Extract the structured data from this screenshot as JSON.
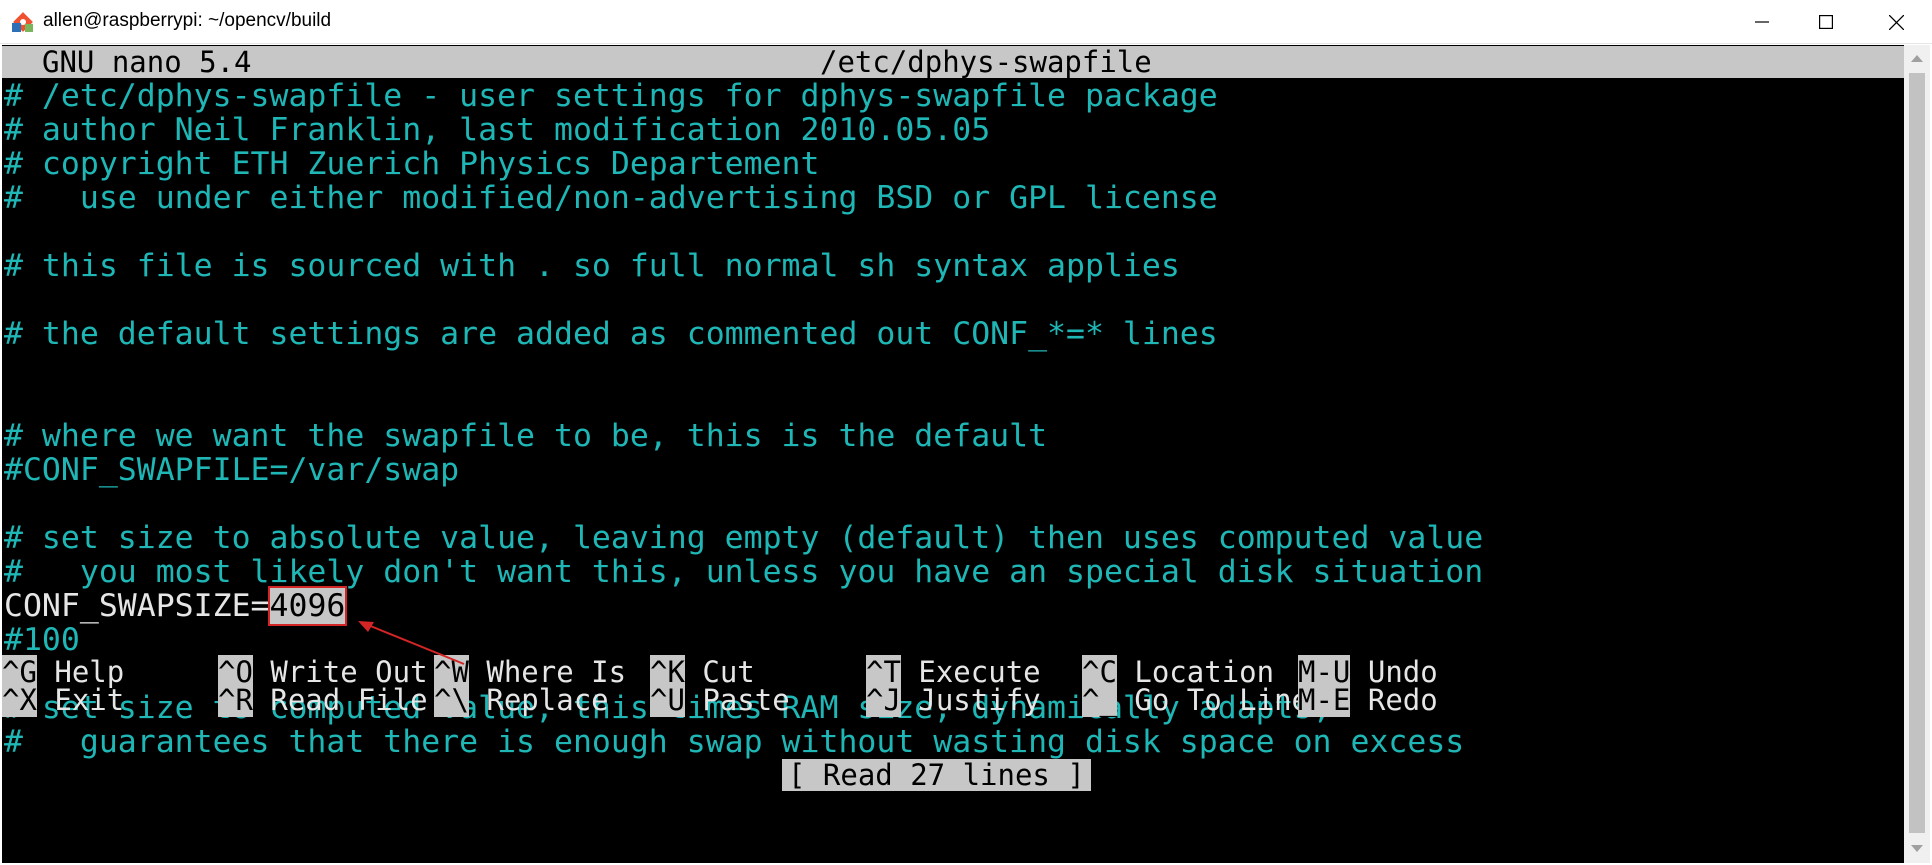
{
  "window": {
    "title": "allen@raspberrypi: ~/opencv/build",
    "icon": "git-bash-icon"
  },
  "nano": {
    "version": "GNU nano 5.4",
    "filename": "/etc/dphys-swapfile"
  },
  "file_lines": [
    {
      "text": "# /etc/dphys-swapfile - user settings for dphys-swapfile package",
      "kind": "comment"
    },
    {
      "text": "# author Neil Franklin, last modification 2010.05.05",
      "kind": "comment"
    },
    {
      "text": "# copyright ETH Zuerich Physics Departement",
      "kind": "comment"
    },
    {
      "text": "#   use under either modified/non-advertising BSD or GPL license",
      "kind": "comment"
    },
    {
      "text": "",
      "kind": "blank"
    },
    {
      "text": "# this file is sourced with . so full normal sh syntax applies",
      "kind": "comment"
    },
    {
      "text": "",
      "kind": "blank"
    },
    {
      "text": "# the default settings are added as commented out CONF_*=* lines",
      "kind": "comment"
    },
    {
      "text": "",
      "kind": "blank"
    },
    {
      "text": "",
      "kind": "blank"
    },
    {
      "text": "# where we want the swapfile to be, this is the default",
      "kind": "comment"
    },
    {
      "text": "#CONF_SWAPFILE=/var/swap",
      "kind": "comment"
    },
    {
      "text": "",
      "kind": "blank"
    },
    {
      "text": "# set size to absolute value, leaving empty (default) then uses computed value",
      "kind": "comment"
    },
    {
      "text": "#   you most likely don't want this, unless you have an special disk situation",
      "kind": "comment"
    },
    {
      "text": "",
      "kind": "setting"
    },
    {
      "text": "#100",
      "kind": "comment"
    },
    {
      "text": "",
      "kind": "blank"
    },
    {
      "text": "# set size to computed value, this times RAM size, dynamically adapts,",
      "kind": "comment"
    },
    {
      "text": "#   guarantees that there is enough swap without wasting disk space on excess",
      "kind": "comment"
    }
  ],
  "setting_line": {
    "key": "CONF_SWAPSIZE=",
    "value": "4096"
  },
  "status_message": "[ Read 27 lines ]",
  "shortcuts": [
    {
      "key": "^G",
      "label": "Help"
    },
    {
      "key": "^O",
      "label": "Write Out"
    },
    {
      "key": "^W",
      "label": "Where Is"
    },
    {
      "key": "^K",
      "label": "Cut"
    },
    {
      "key": "^T",
      "label": "Execute"
    },
    {
      "key": "^C",
      "label": "Location"
    },
    {
      "key": "M-U",
      "label": "Undo"
    },
    {
      "key": "^X",
      "label": "Exit"
    },
    {
      "key": "^R",
      "label": "Read File"
    },
    {
      "key": "^\\",
      "label": "Replace"
    },
    {
      "key": "^U",
      "label": "Paste"
    },
    {
      "key": "^J",
      "label": "Justify"
    },
    {
      "key": "^_",
      "label": "Go To Line"
    },
    {
      "key": "M-E",
      "label": "Redo"
    }
  ],
  "colors": {
    "comment": "#1fb6b6",
    "text": "#e6e6e6",
    "inverse_bg": "#c7c7c7",
    "annotation": "#d32525",
    "terminal_bg": "#000000"
  }
}
